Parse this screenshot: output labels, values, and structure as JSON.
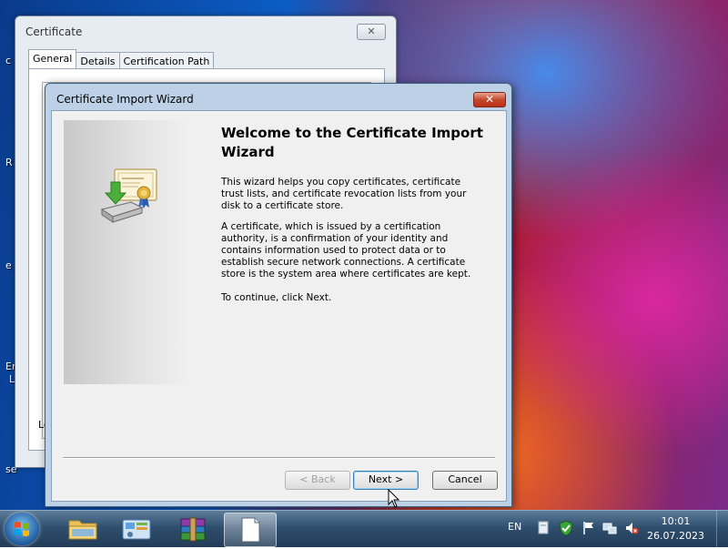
{
  "desktop": {
    "edge_labels": [
      "c",
      "R",
      "e",
      "Er",
      "L",
      "se"
    ]
  },
  "certificate_window": {
    "title": "Certificate",
    "close_label": "✕",
    "tabs": [
      "General",
      "Details",
      "Certification Path"
    ],
    "fragment_text": "Le"
  },
  "wizard": {
    "title": "Certificate Import Wizard",
    "close_label": "✕",
    "heading": "Welcome to the Certificate Import Wizard",
    "paragraphs": [
      "This wizard helps you copy certificates, certificate trust lists, and certificate revocation lists from your disk to a certificate store.",
      "A certificate, which is issued by a certification authority, is a confirmation of your identity and contains information used to protect data or to establish secure network connections. A certificate store is the system area where certificates are kept.",
      "To continue, click Next."
    ],
    "buttons": {
      "back": "< Back",
      "next": "Next >",
      "cancel": "Cancel"
    }
  },
  "taskbar": {
    "items": [
      "explorer-folder-icon",
      "control-panel-icon",
      "winrar-icon",
      "blank-document-icon"
    ],
    "language": "EN",
    "clock_time": "10:01",
    "clock_date": "26.07.2023"
  }
}
